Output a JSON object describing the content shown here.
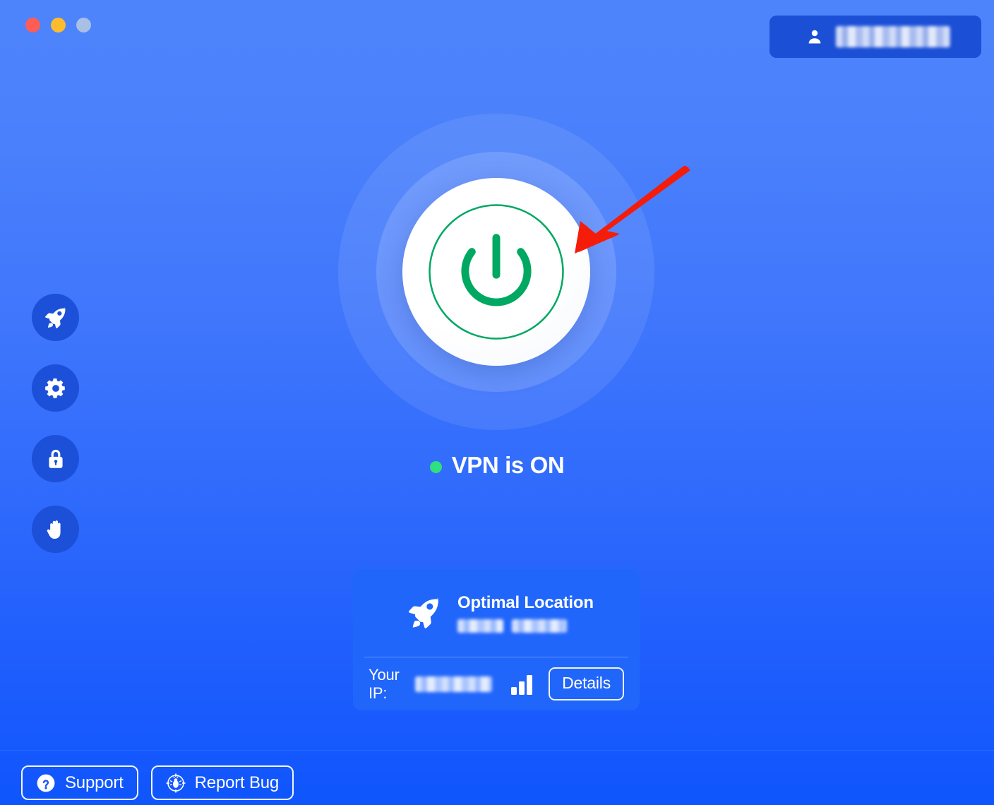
{
  "window": {
    "controls": [
      {
        "name": "close",
        "color": "#fd5d55"
      },
      {
        "name": "minimize",
        "color": "#fdbc2e"
      },
      {
        "name": "maximize",
        "color": "#a9bfe3"
      }
    ]
  },
  "header": {
    "account": {
      "icon": "person-icon",
      "label_redacted": true,
      "label": ""
    }
  },
  "sidebar": {
    "items": [
      {
        "icon": "rocket-icon",
        "name": "locations"
      },
      {
        "icon": "gear-icon",
        "name": "settings"
      },
      {
        "icon": "lock-icon",
        "name": "security"
      },
      {
        "icon": "hand-icon",
        "name": "block"
      }
    ]
  },
  "main": {
    "power_button": {
      "icon": "power-icon",
      "state": "on",
      "accent_color": "#00a862"
    },
    "status": {
      "dot_color": "#2ee07e",
      "text": "VPN is ON"
    },
    "location_card": {
      "icon": "rocket-icon",
      "title": "Optimal Location",
      "subtitle_redacted": true,
      "subtitle": "",
      "ip_label": "Your IP:",
      "ip_value_redacted": true,
      "ip_value": "",
      "signal_icon": "signal-bars-icon",
      "details_label": "Details"
    }
  },
  "footer": {
    "buttons": [
      {
        "icon": "question-circle-icon",
        "label": "Support"
      },
      {
        "icon": "bug-target-icon",
        "label": "Report Bug"
      }
    ]
  },
  "annotation": {
    "type": "arrow",
    "color": "#f51c0a",
    "points_to": "power-button"
  },
  "colors": {
    "background_top": "#4e84fb",
    "background_bottom": "#0f55fd",
    "card": "#2166fb",
    "sidebar_circle": "#1c50d8",
    "accent_green": "#00a862"
  }
}
